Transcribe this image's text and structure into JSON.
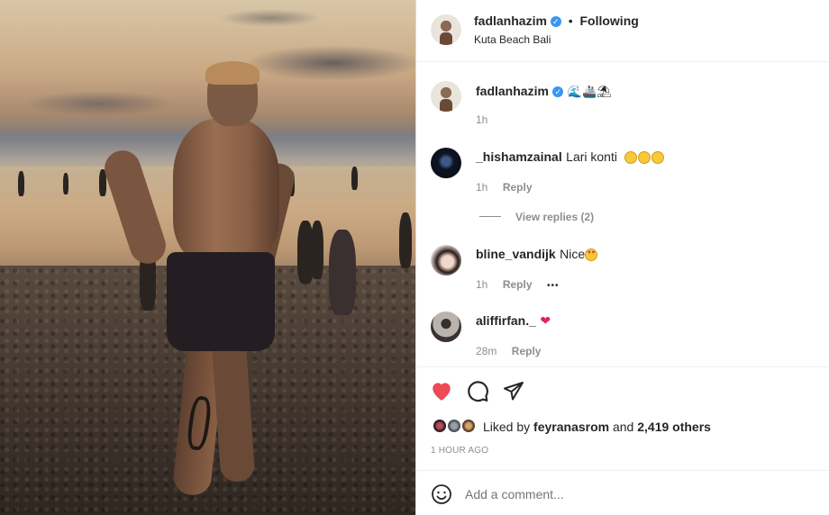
{
  "post": {
    "owner": "fadlanhazim",
    "location": "Kuta Beach Bali",
    "follow_status": "Following",
    "separator": "•",
    "caption": "🌊🚢⛱",
    "caption_time": "1h",
    "liked_by_prefix": "Liked by",
    "liked_by_user": "feyranasrom",
    "liked_by_and": "and",
    "liked_by_count": "2,419 others",
    "posted_ago": "1 HOUR AGO"
  },
  "comments": [
    {
      "user": "_hishamzainal",
      "text": "Lari konti",
      "time": "1h",
      "reply": "Reply",
      "view_replies": "View replies (2)"
    },
    {
      "user": "bline_vandijk",
      "text": "Nice",
      "time": "1h",
      "reply": "Reply",
      "more": "•••"
    },
    {
      "user": "aliffirfan._",
      "text": "❤",
      "time": "28m",
      "reply": "Reply"
    }
  ],
  "composer": {
    "placeholder": "Add a comment...",
    "emoji_icon": "smiley-icon"
  },
  "actions": {
    "like_icon": "heart-filled-icon",
    "comment_icon": "speech-bubble-icon",
    "share_icon": "paper-plane-icon"
  },
  "colors": {
    "heart": "#ed4956",
    "verified": "#3897f0",
    "muted": "#8e8e8e",
    "text": "#262626",
    "divider": "#efefef"
  }
}
